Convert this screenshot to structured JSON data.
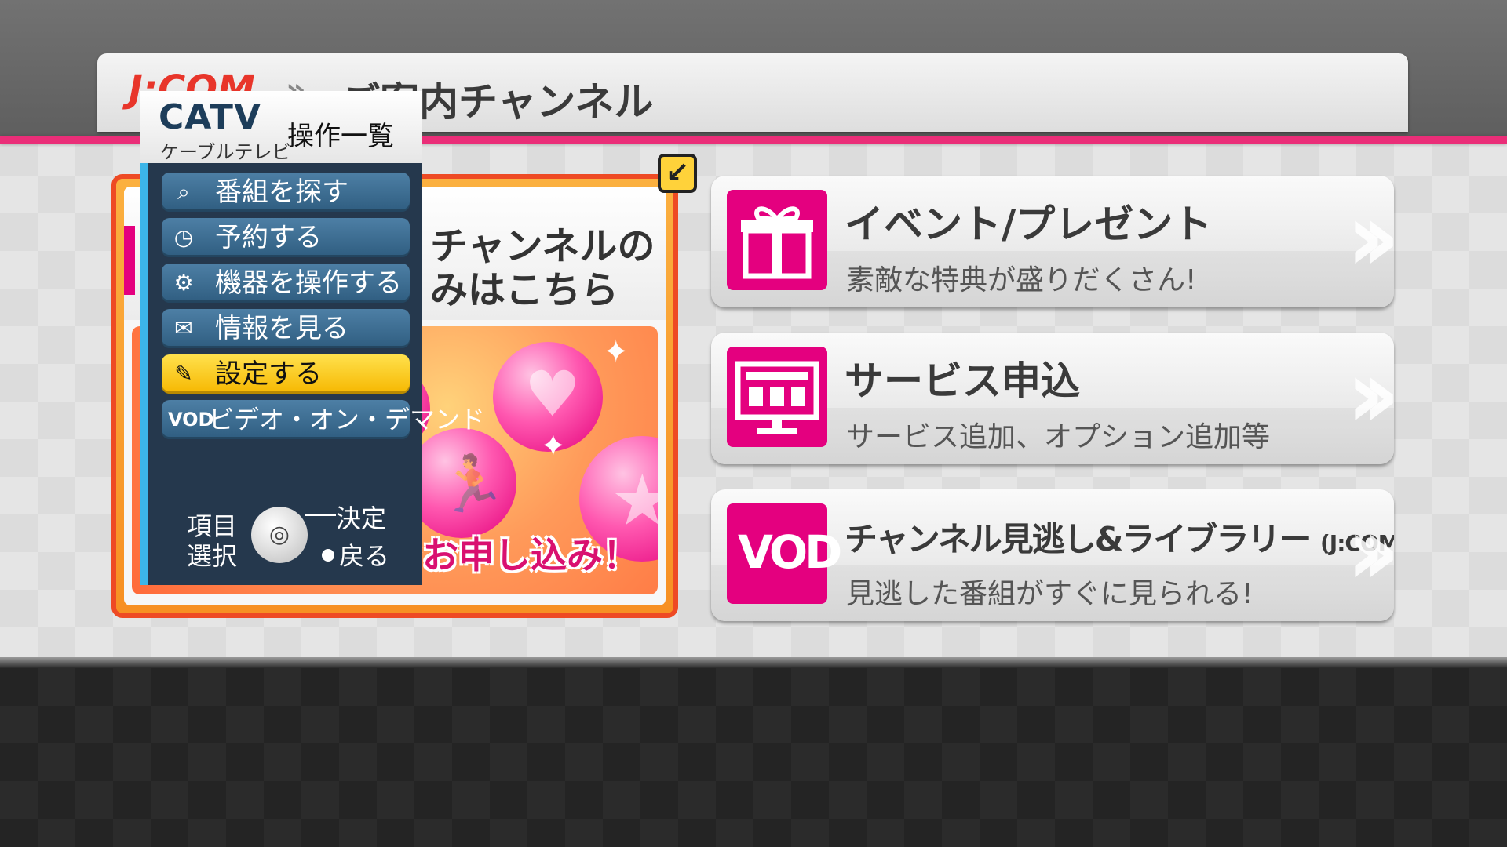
{
  "header": {
    "brand": "J:COM",
    "separator": "»",
    "title": "ご案内チャンネル"
  },
  "promo": {
    "heading_line1": "チャンネルの",
    "heading_line2": "みはこちら",
    "cta": "ンお申し込み！"
  },
  "menu": {
    "logo": "CATV",
    "logo_sub": "ケーブルテレビ",
    "title": "操作一覧",
    "items": [
      {
        "label": "番組を探す",
        "icon": "search-icon"
      },
      {
        "label": "予約する",
        "icon": "clock-icon"
      },
      {
        "label": "機器を操作する",
        "icon": "device-icon"
      },
      {
        "label": "情報を見る",
        "icon": "mail-icon"
      },
      {
        "label": "設定する",
        "icon": "wrench-icon",
        "selected": true
      },
      {
        "label": "ビデオ・オン・デマンド",
        "tag": "VOD"
      }
    ],
    "help": {
      "select_line1": "項目",
      "select_line2": "選択",
      "ok": "決定",
      "back": "戻る"
    }
  },
  "cards": [
    {
      "title": "イベント/プレゼント",
      "subtitle": "素敵な特典が盛りだくさん!",
      "icon": "gift-icon"
    },
    {
      "title": "サービス申込",
      "subtitle": "サービス追加、オプション追加等",
      "icon": "monitor-check-icon"
    },
    {
      "title": "チャンネル見逃し&ライブラリー",
      "title_tag": "(J:COM オン デマンド)",
      "subtitle": "見逃した番組がすぐに見られる!",
      "icon": "vod-icon",
      "icon_text": "VOD"
    }
  ],
  "colors": {
    "accent_pink": "#e4007f",
    "menu_bg": "#25384d",
    "menu_selected": "#f6b700",
    "promo_border": "#ee4a24"
  }
}
